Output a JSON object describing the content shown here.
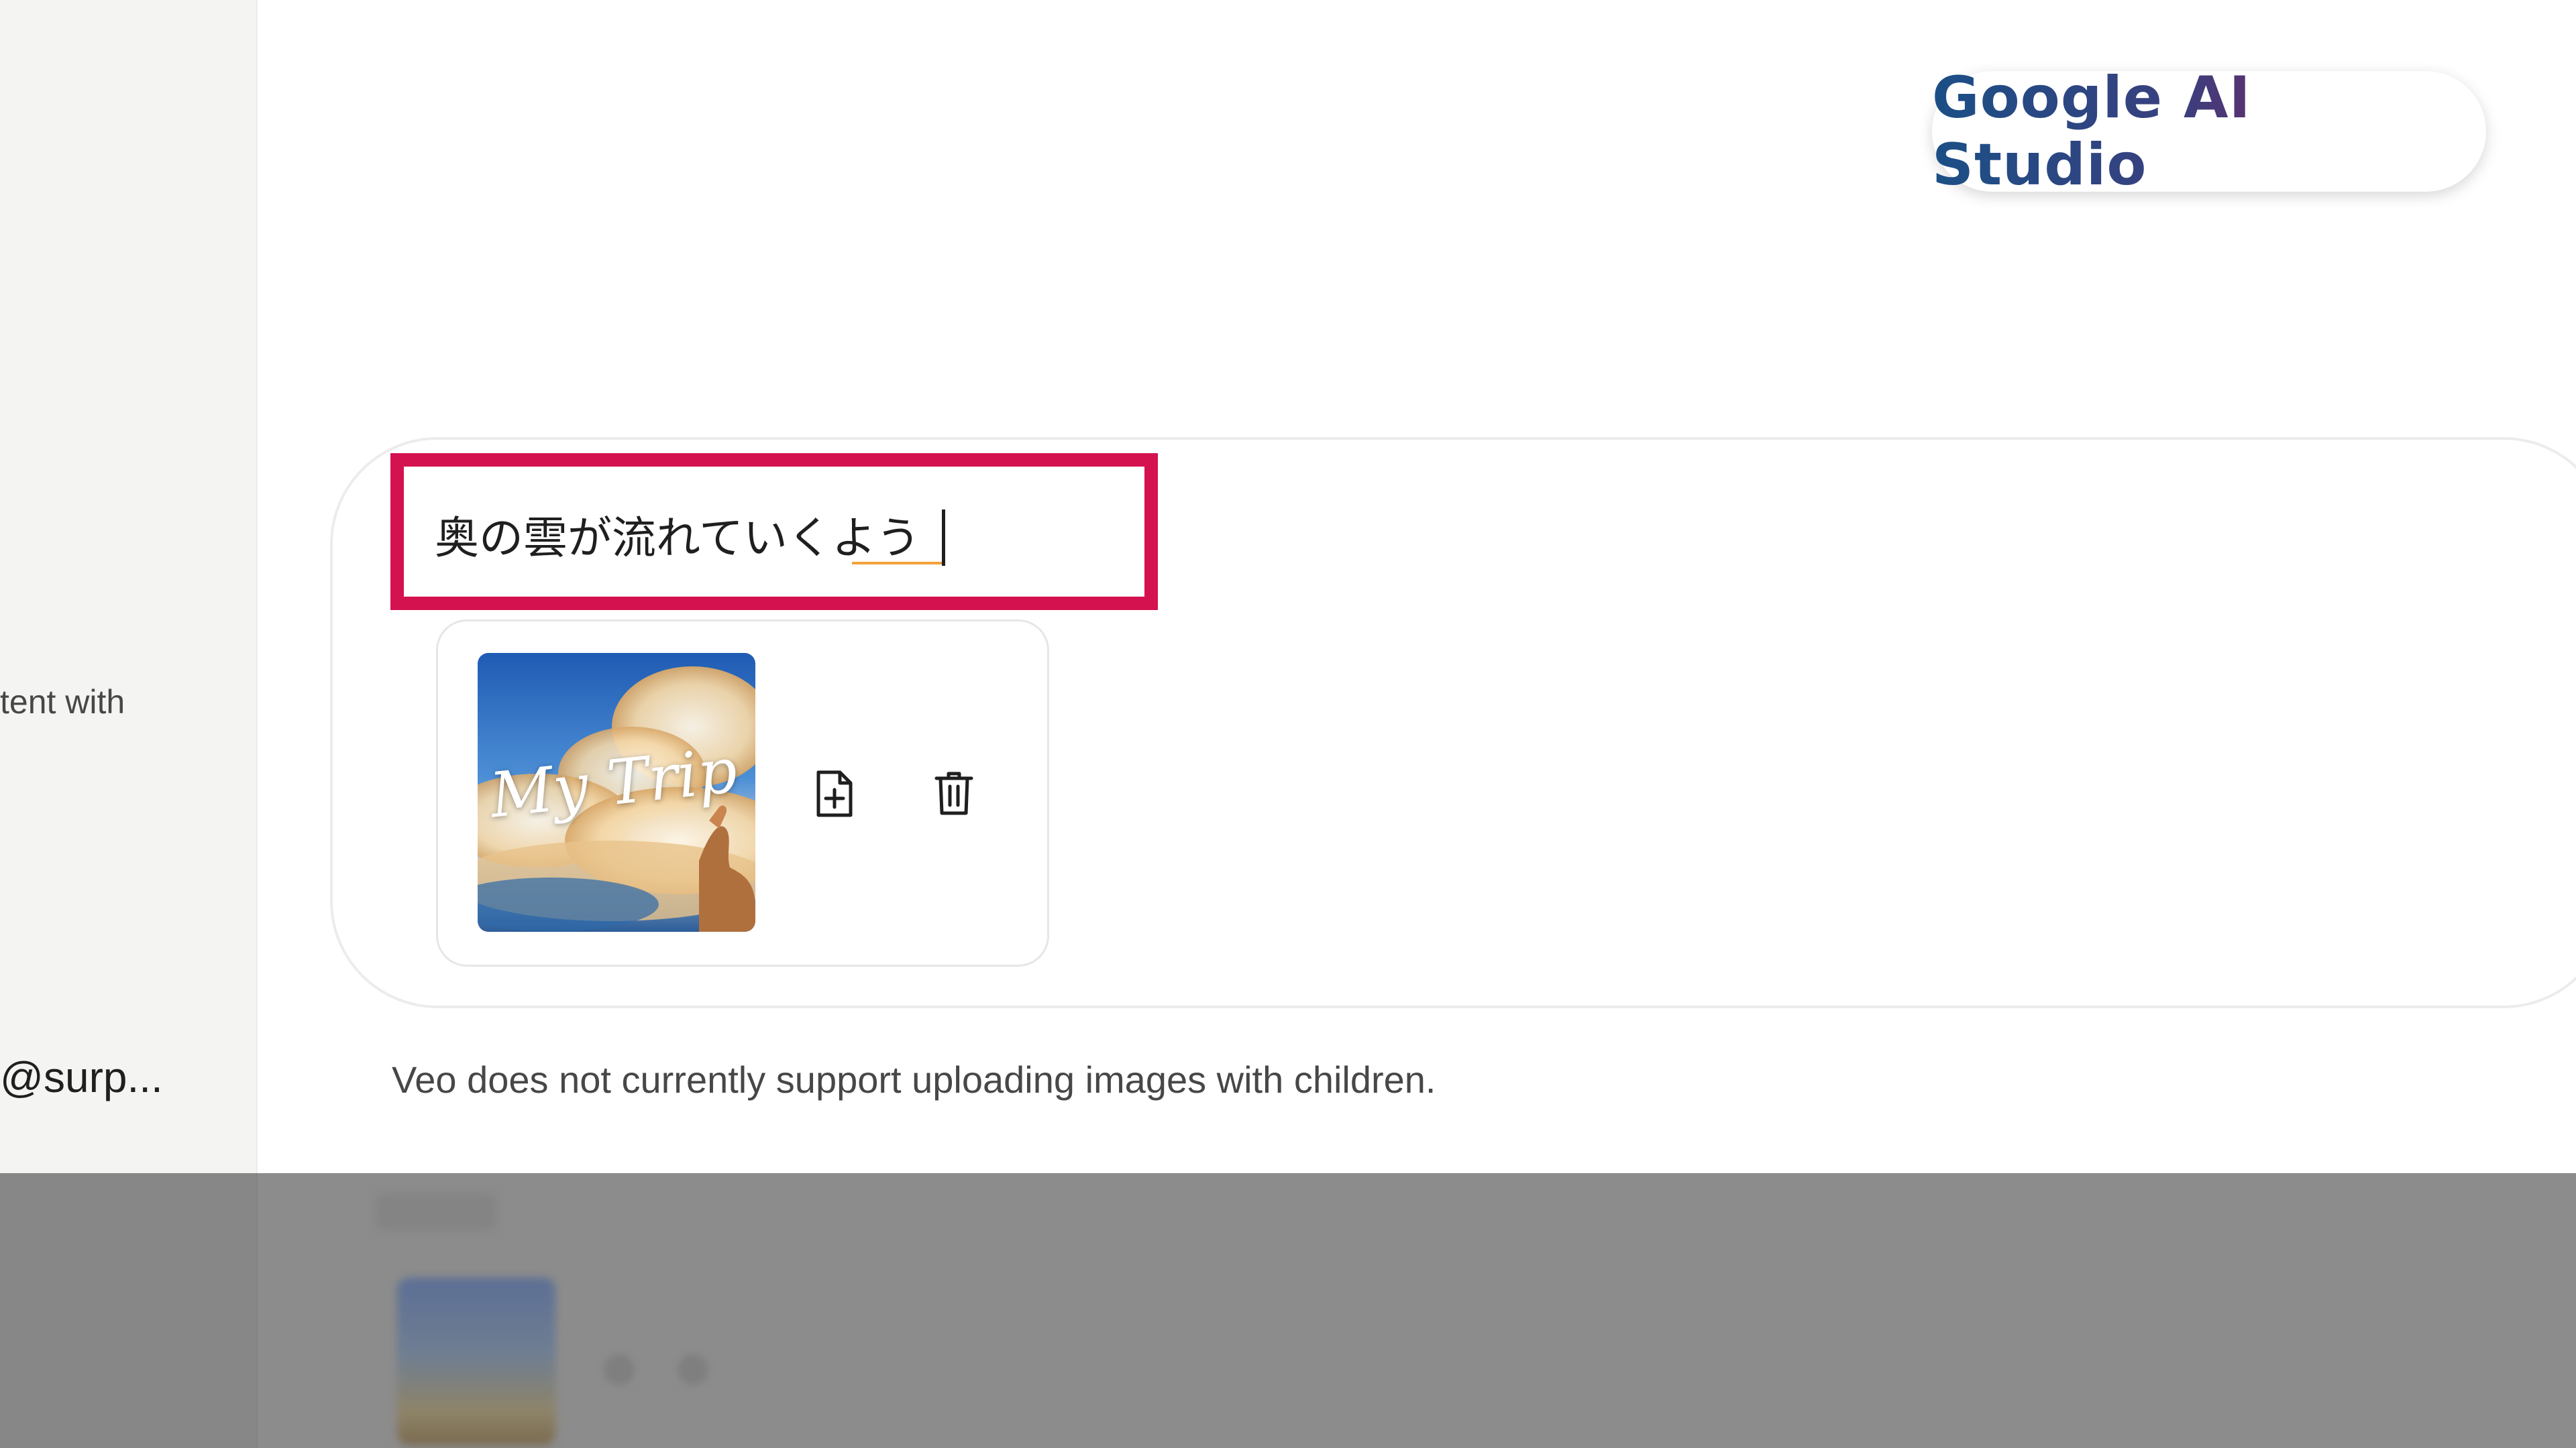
{
  "app": {
    "brand": "Google AI Studio"
  },
  "sidebar": {
    "text_fragment": "tent with",
    "account_label": "@surp..."
  },
  "composer": {
    "prompt_value": "奥の雲が流れていくよう",
    "attachment": {
      "thumbnail_caption": "My Trip",
      "actions": [
        {
          "icon": "file-add-icon"
        },
        {
          "icon": "trash-icon"
        }
      ]
    }
  },
  "notice": "Veo does not currently support uploading images with children.",
  "colors": {
    "highlight": "#d4124f",
    "brand_start": "#1b4f86",
    "brand_end": "#a31550",
    "sidebar_bg": "#f4f4f2",
    "overlay": "#8c8c8c"
  }
}
